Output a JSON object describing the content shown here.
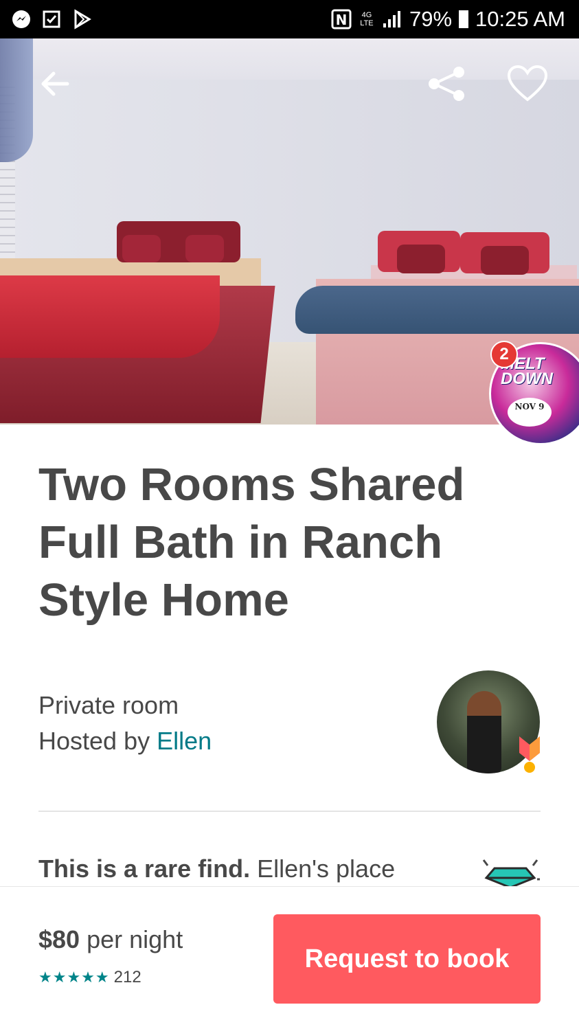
{
  "status_bar": {
    "notifications": [
      "messenger-icon",
      "checkbox-icon",
      "play-store-icon"
    ],
    "nfc": "N",
    "network": "4G LTE",
    "battery": "79%",
    "time": "10:25 AM"
  },
  "hero": {
    "back": "arrow-left-icon",
    "share": "share-icon",
    "save": "heart-icon",
    "chat_head_badge": "2",
    "chat_head_text": "MELT DOWN",
    "chat_head_date": "NOV 9"
  },
  "listing": {
    "title": "Two Rooms  Shared Full Bath in Ranch Style Home",
    "room_type": "Private room",
    "hosted_by_label": "Hosted by",
    "host_name": "Ellen",
    "rare_find_bold": "This is a rare find.",
    "rare_find_text": "Ellen's place"
  },
  "booking": {
    "price": "$80",
    "per_night": "per night",
    "stars": "★★★★★",
    "review_count": "212",
    "button_label": "Request to book"
  },
  "colors": {
    "accent": "#ff5a5f",
    "link": "#007a87",
    "stars": "#008489",
    "text": "#484848"
  }
}
